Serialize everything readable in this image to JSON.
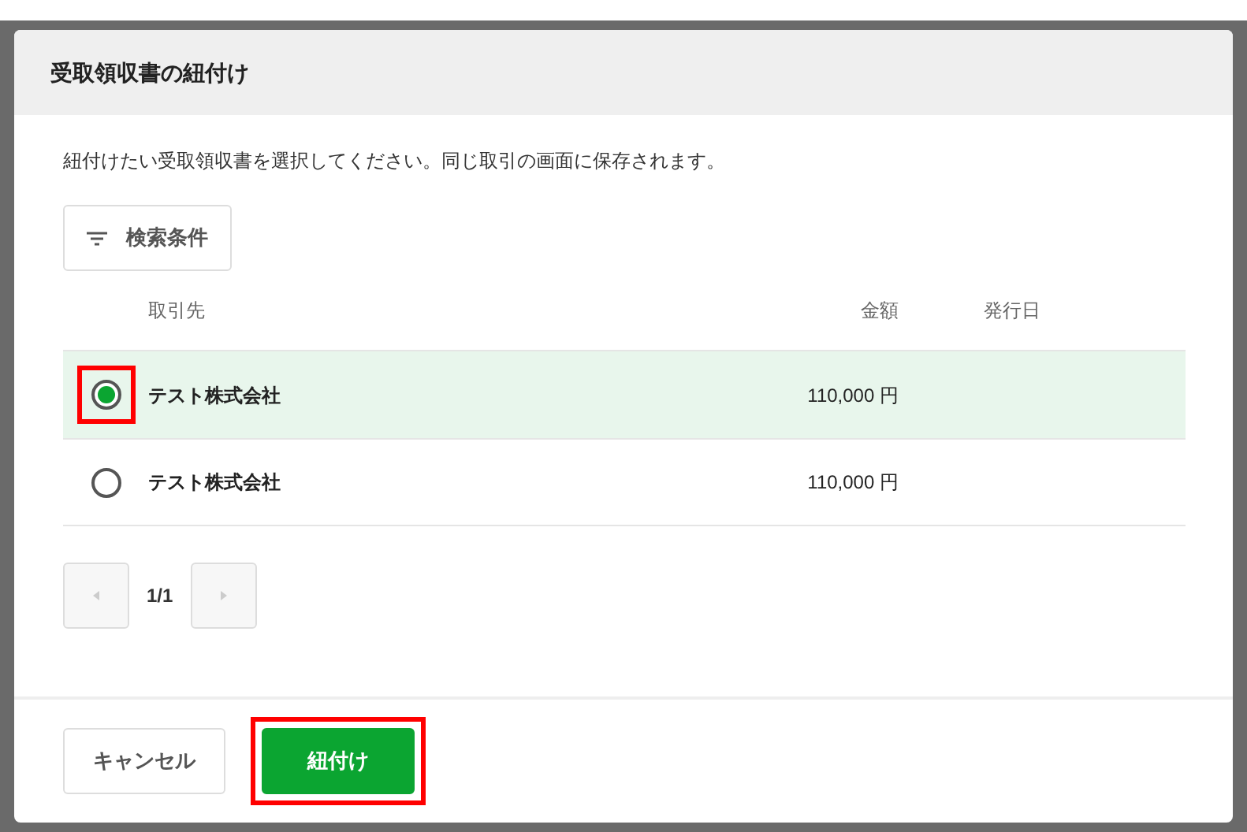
{
  "dialog": {
    "title": "受取領収書の紐付け",
    "description": "紐付けたい受取領収書を選択してください。同じ取引の画面に保存されます。",
    "filter_button": "検索条件",
    "table": {
      "columns": [
        "取引先",
        "金額",
        "発行日"
      ],
      "rows": [
        {
          "partner": "テスト株式会社",
          "amount": "110,000 円",
          "selected": true,
          "highlighted": true
        },
        {
          "partner": "テスト株式会社",
          "amount": "110,000 円",
          "selected": false,
          "highlighted": false
        }
      ]
    },
    "pagination": {
      "page": "1/1",
      "prev_disabled": true,
      "next_disabled": true
    },
    "buttons": [
      {
        "label": "キャンセル",
        "kind": "secondary",
        "highlighted": false
      },
      {
        "label": "紐付け",
        "kind": "primary",
        "highlighted": true
      }
    ]
  }
}
